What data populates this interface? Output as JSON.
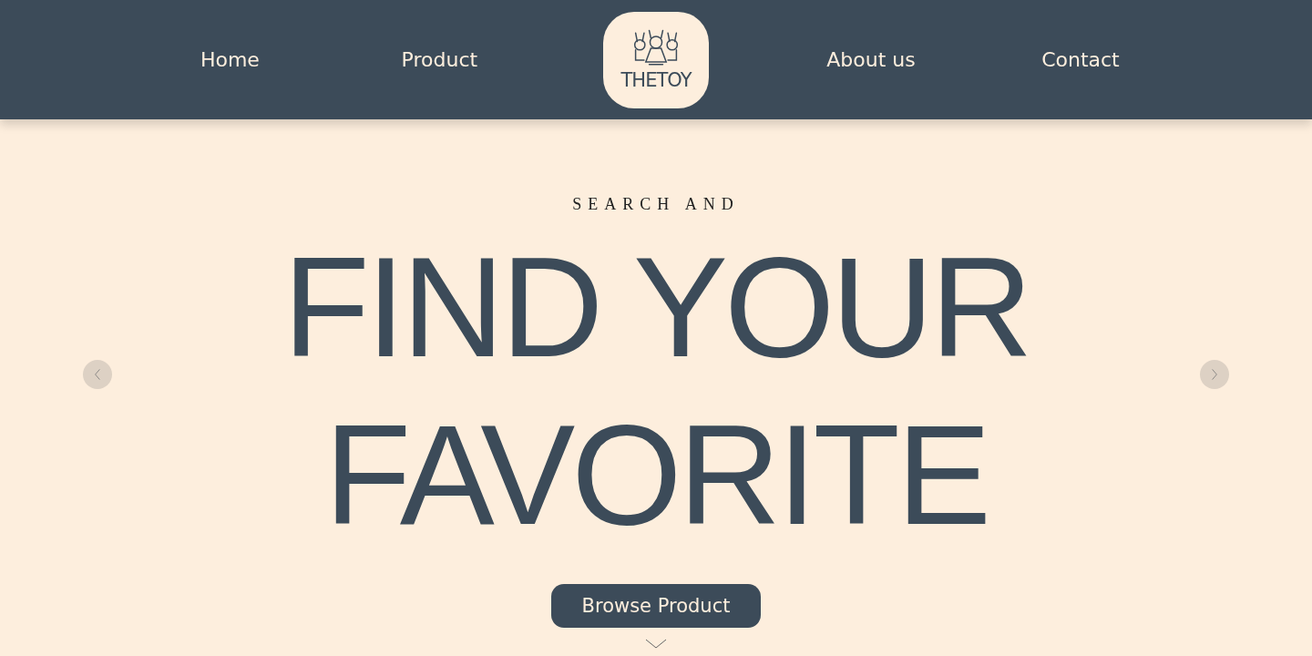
{
  "nav": {
    "left": [
      {
        "label": "Home"
      },
      {
        "label": "Product"
      }
    ],
    "logo": {
      "text": "THETOY"
    },
    "right": [
      {
        "label": "About us"
      },
      {
        "label": "Contact"
      }
    ]
  },
  "hero": {
    "kicker": "SEARCH AND",
    "headline": [
      "FIND YOUR",
      "FAVORITE"
    ],
    "button": "Browse Product"
  }
}
